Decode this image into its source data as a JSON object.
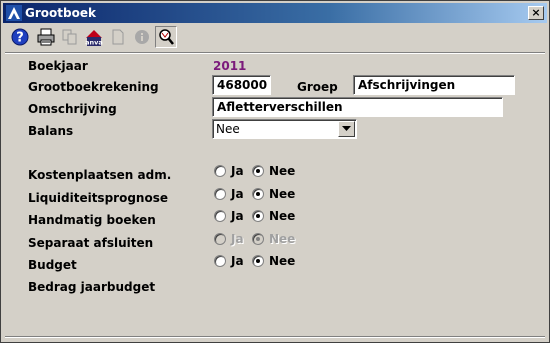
{
  "window": {
    "title": "Grootboek",
    "close_label": "×"
  },
  "toolbar": {
    "buttons": [
      {
        "name": "help-icon",
        "enabled": true
      },
      {
        "name": "print-icon",
        "enabled": true
      },
      {
        "name": "copy-icon",
        "enabled": false
      },
      {
        "name": "anva-icon",
        "label": "anva",
        "enabled": true
      },
      {
        "name": "new-document-icon",
        "enabled": false
      },
      {
        "name": "info-icon",
        "enabled": false
      },
      {
        "name": "search-icon",
        "enabled": true,
        "pressed": true
      }
    ]
  },
  "form": {
    "boekjaar": {
      "label": "Boekjaar",
      "value": "2011"
    },
    "grootboekrekening": {
      "label": "Grootboekrekening",
      "value": "468000"
    },
    "groep": {
      "label": "Groep",
      "value": "Afschrijvingen"
    },
    "omschrijving": {
      "label": "Omschrijving",
      "value": "Afletterverschillen"
    },
    "balans": {
      "label": "Balans",
      "value": "Nee"
    },
    "options": [
      {
        "label": "Kostenplaatsen  adm.",
        "ja": "Ja",
        "nee": "Nee",
        "selected": "nee",
        "enabled": true
      },
      {
        "label": "Liquiditeitsprognose",
        "ja": "Ja",
        "nee": "Nee",
        "selected": "nee",
        "enabled": true
      },
      {
        "label": "Handmatig boeken",
        "ja": "Ja",
        "nee": "Nee",
        "selected": "nee",
        "enabled": true
      },
      {
        "label": "Separaat afsluiten",
        "ja": "Ja",
        "nee": "Nee",
        "selected": "nee",
        "enabled": false
      },
      {
        "label": "Budget",
        "ja": "Ja",
        "nee": "Nee",
        "selected": "nee",
        "enabled": true
      }
    ],
    "bedrag_jaarbudget": {
      "label": "Bedrag jaarbudget"
    }
  },
  "colors": {
    "title_gradient_start": "#0a246a",
    "title_gradient_end": "#a6caf0",
    "boekjaar_value": "#7b1a7b",
    "window_bg": "#d4d0c8"
  }
}
